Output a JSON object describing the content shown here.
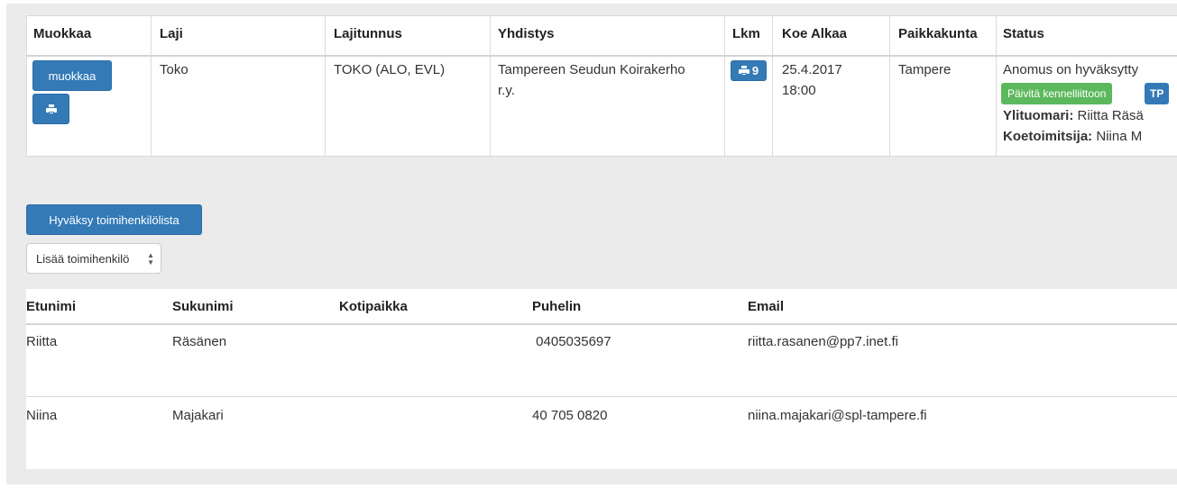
{
  "top_table": {
    "headers": {
      "muokkaa": "Muokkaa",
      "laji": "Laji",
      "lajitunnus": "Lajitunnus",
      "yhdistys": "Yhdistys",
      "lkm": "Lkm",
      "koe_alkaa": "Koe Alkaa",
      "paikkakunta": "Paikkakunta",
      "status": "Status"
    },
    "row": {
      "edit_button": "muokkaa",
      "print_icon": "print-icon",
      "laji": "Toko",
      "lajitunnus": "TOKO (ALO, EVL)",
      "yhdistys_line1": "Tampereen Seudun Koirakerho",
      "yhdistys_line2": "r.y.",
      "lkm_count": "9",
      "koe_alkaa_date": "25.4.2017",
      "koe_alkaa_time": "18:00",
      "paikkakunta": "Tampere",
      "status_text": "Anomus on hyväksytty",
      "update_button": "Päivitä kennelliittoon",
      "blue_badge": "TP",
      "ylituomari_label": "Ylituomari:",
      "ylituomari_value": " Riitta Räsä",
      "koetoimitsija_label": "Koetoimitsija:",
      "koetoimitsija_value": " Niina M"
    }
  },
  "actions": {
    "approve_button": "Hyväksy toimihenkilölista",
    "add_select": "Lisää toimihenkilö"
  },
  "staff_table": {
    "headers": [
      "Etunimi",
      "Sukunimi",
      "Kotipaikka",
      "Puhelin",
      "Email"
    ],
    "rows": [
      {
        "etunimi": "Riitta",
        "sukunimi": "Räsänen",
        "kotipaikka": "",
        "puhelin": " 0405035697",
        "email": "riitta.rasanen@pp7.inet.fi"
      },
      {
        "etunimi": "Niina",
        "sukunimi": "Majakari",
        "kotipaikka": "",
        "puhelin": "40 705 0820",
        "email": "niina.majakari@spl-tampere.fi"
      }
    ]
  },
  "colors": {
    "primary": "#337ab7",
    "success": "#5cb85c",
    "panel_bg": "#ebebeb"
  }
}
